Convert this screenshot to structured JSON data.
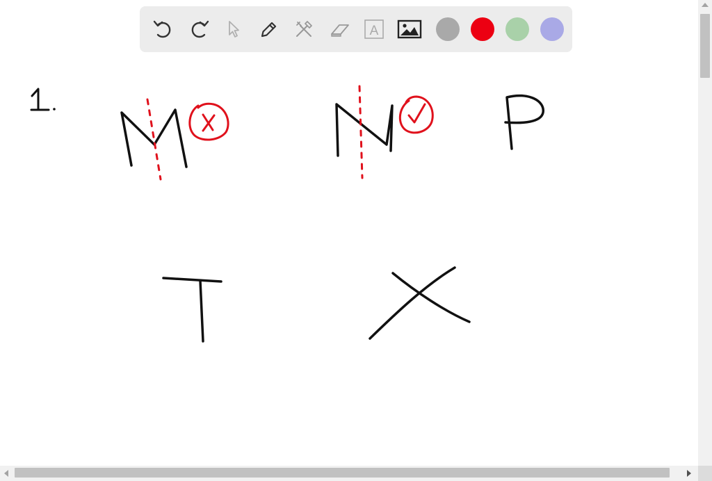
{
  "toolbar": {
    "tools": [
      {
        "id": "undo",
        "icon": "undo-icon"
      },
      {
        "id": "redo",
        "icon": "redo-icon"
      },
      {
        "id": "select",
        "icon": "pointer-icon"
      },
      {
        "id": "pen",
        "icon": "pencil-icon"
      },
      {
        "id": "tools",
        "icon": "crossed-tools-icon"
      },
      {
        "id": "eraser",
        "icon": "eraser-icon"
      },
      {
        "id": "text",
        "icon": "text-box-icon",
        "glyph": "A"
      },
      {
        "id": "image",
        "icon": "image-icon"
      }
    ],
    "swatches": [
      {
        "name": "gray",
        "color": "#a9a9a9"
      },
      {
        "name": "red",
        "color": "#ec0012"
      },
      {
        "name": "green",
        "color": "#a9d1a9"
      },
      {
        "name": "purple",
        "color": "#a9a9e6"
      }
    ]
  },
  "canvas": {
    "ink_color": "#111111",
    "mark_color": "#e0111c",
    "item_number": "1."
  }
}
